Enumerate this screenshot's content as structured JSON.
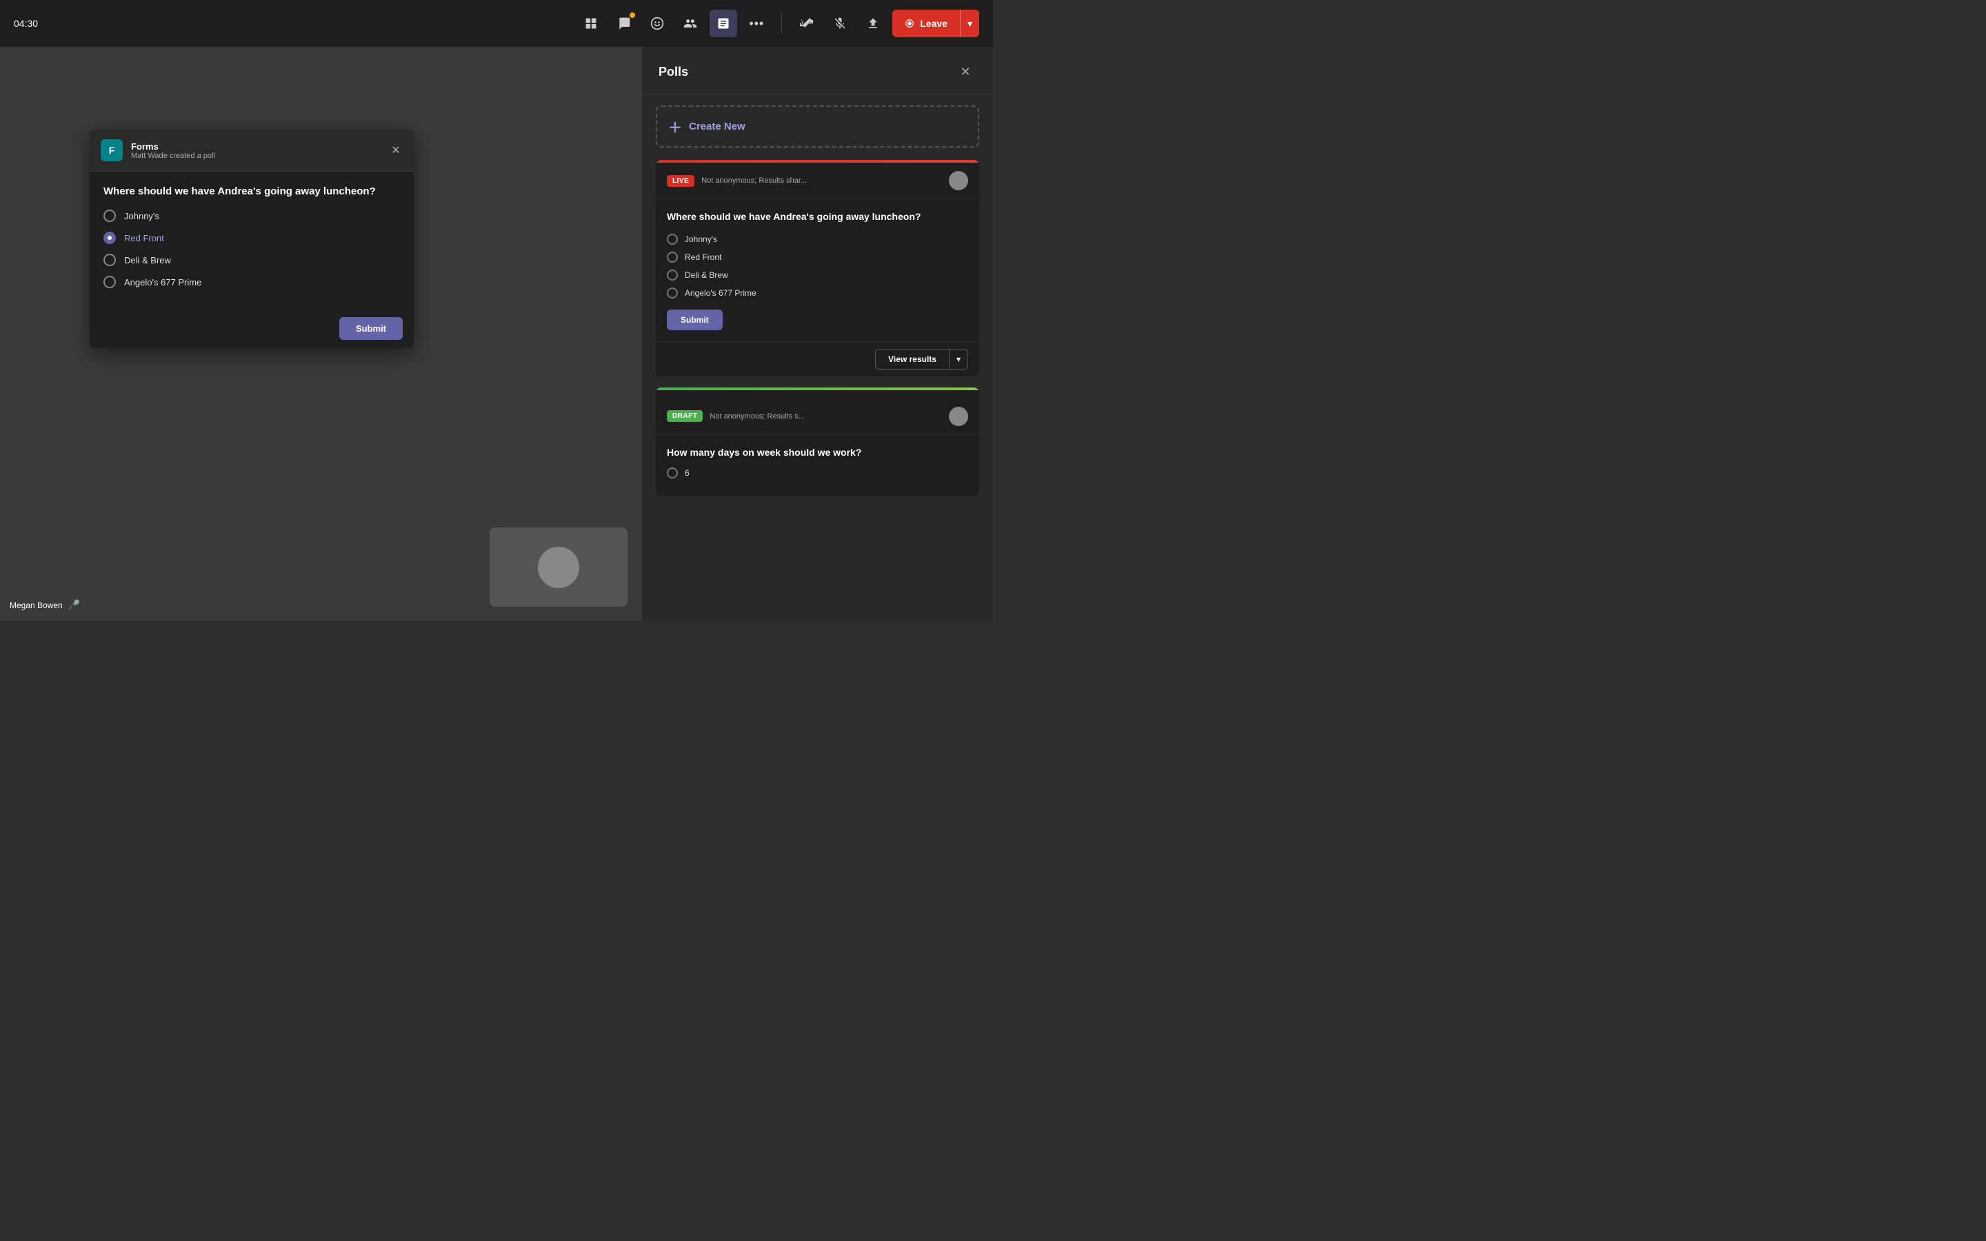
{
  "timer": "04:30",
  "toolbar": {
    "apps_icon": "⊞",
    "chat_icon": "💬",
    "reactions_icon": "😊",
    "participants_icon": "👥",
    "share_icon": "📊",
    "more_icon": "•••",
    "cam_icon": "🎥",
    "mic_icon": "🎤",
    "raise_icon": "↑",
    "leave_label": "Leave"
  },
  "main": {
    "user_name": "Megan Bowen"
  },
  "poll_notification": {
    "app_name": "Forms",
    "created_by": "Matt Wade created a poll",
    "question": "Where should we have Andrea's going away luncheon?",
    "options": [
      {
        "id": 1,
        "label": "Johnny's",
        "selected": false
      },
      {
        "id": 2,
        "label": "Red Front",
        "selected": true
      },
      {
        "id": 3,
        "label": "Deli & Brew",
        "selected": false
      },
      {
        "id": 4,
        "label": "Angelo's 677 Prime",
        "selected": false
      }
    ],
    "submit_label": "Submit"
  },
  "polls_panel": {
    "title": "Polls",
    "create_new_label": "Create New",
    "live_poll": {
      "badge": "LIVE",
      "meta": "Not anonymous; Results shar...",
      "question": "Where should we have Andrea's going away luncheon?",
      "options": [
        {
          "label": "Johnny's"
        },
        {
          "label": "Red Front"
        },
        {
          "label": "Deli & Brew"
        },
        {
          "label": "Angelo's 677 Prime"
        }
      ],
      "submit_label": "Submit",
      "view_results_label": "View results"
    },
    "draft_poll": {
      "badge": "DRAFT",
      "meta": "Not anonymous; Results s...",
      "question": "How many days on week should we work?",
      "options": [
        {
          "label": "6"
        }
      ]
    }
  }
}
